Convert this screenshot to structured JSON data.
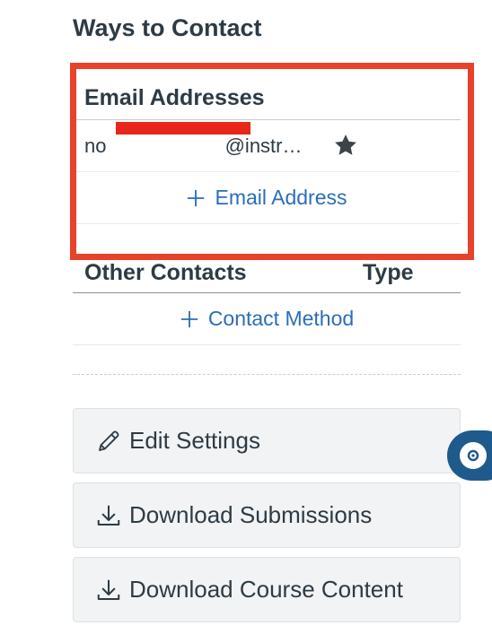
{
  "ways_to_contact": {
    "heading": "Ways to Contact",
    "email_section": {
      "header": "Email Addresses",
      "email_visible_text": "no                              @instr…",
      "add_label": "Email Address"
    },
    "other_contacts": {
      "header": "Other Contacts",
      "type_header": "Type",
      "add_label": "Contact Method"
    }
  },
  "actions": {
    "edit_settings": "Edit Settings",
    "download_submissions": "Download Submissions",
    "download_course_content": "Download Course Content"
  },
  "colors": {
    "link": "#2b6eb8",
    "highlight": "#e8422a",
    "redaction": "#e8261a",
    "help_button": "#1f5a8c"
  },
  "icons": {
    "default_email": "star-icon",
    "add": "plus-icon",
    "edit": "pencil-icon",
    "download": "download-icon",
    "help": "help-icon"
  }
}
